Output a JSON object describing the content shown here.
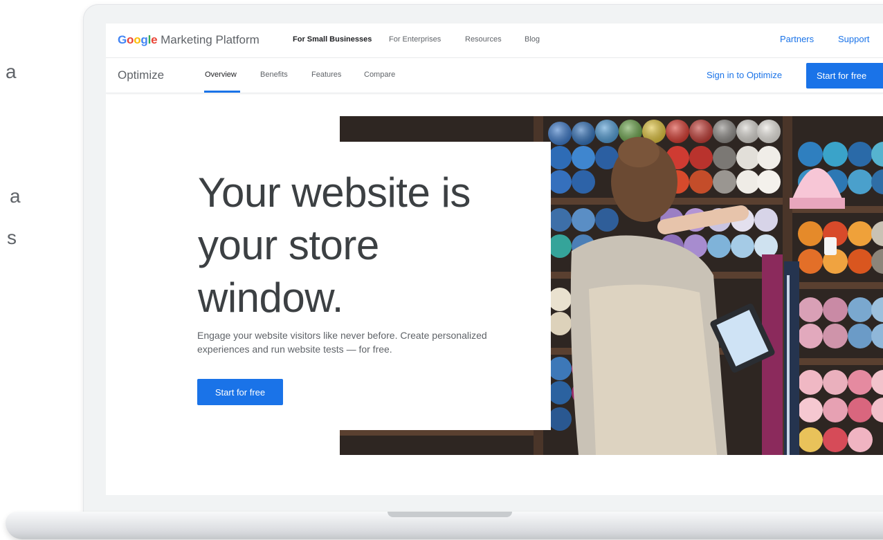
{
  "background_page": {
    "glyphs": [
      "a",
      "a",
      "s"
    ]
  },
  "topnav": {
    "brand_google": [
      "G",
      "o",
      "o",
      "g",
      "l",
      "e"
    ],
    "brand_suffix": "Marketing Platform",
    "links": [
      "For Small Businesses",
      "For Enterprises",
      "Resources",
      "Blog"
    ],
    "active_link": "For Small Businesses",
    "right_links": [
      "Partners",
      "Support"
    ]
  },
  "subnav": {
    "product": "Optimize",
    "tabs": [
      "Overview",
      "Benefits",
      "Features",
      "Compare"
    ],
    "active_tab": "Overview",
    "signin": "Sign in to Optimize",
    "cta": "Start for free"
  },
  "hero": {
    "title": "Your website is your store window.",
    "description": "Engage your website visitors like never before. Create personalized experiences and run website tests — for free.",
    "cta": "Start for free",
    "photo_alt": "Woman browsing yarn shelves holding a tablet"
  },
  "colors": {
    "accent": "#1a73e8",
    "text_dark": "#3c4043",
    "text_muted": "#5f6368",
    "google_blue": "#4285f4",
    "google_red": "#ea4335",
    "google_yellow": "#fbbc05",
    "google_green": "#34a853"
  }
}
